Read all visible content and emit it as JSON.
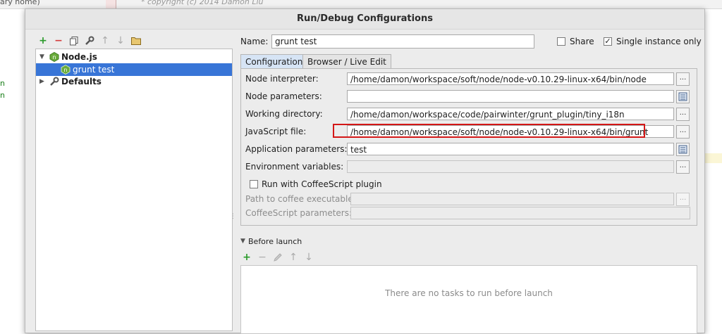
{
  "background": {
    "top_text": "ary home)",
    "code_text": "* copyright (c) 2014 Damon Liu",
    "left_fragments": [
      "n",
      "n"
    ]
  },
  "dialog": {
    "title": "Run/Debug Configurations"
  },
  "left_toolbar": {
    "add": "+",
    "remove": "−",
    "copy": "copy-icon",
    "edit_defaults": "wrench-icon",
    "move_up": "↑",
    "move_down": "↓",
    "folder": "folder-icon"
  },
  "tree": {
    "nodejs": "Node.js",
    "grunt_test": "grunt test",
    "defaults": "Defaults"
  },
  "header": {
    "name_label": "Name:",
    "name_value": "grunt test",
    "share_label": "Share",
    "share_checked": false,
    "single_instance_label": "Single instance only",
    "single_instance_checked": true
  },
  "tabs": [
    {
      "label": "Configuration",
      "active": true
    },
    {
      "label": "Browser / Live Edit",
      "active": false
    }
  ],
  "config": {
    "node_interpreter_label": "Node interpreter:",
    "node_interpreter_value": "/home/damon/workspace/soft/node/node-v0.10.29-linux-x64/bin/node",
    "node_parameters_label": "Node parameters:",
    "node_parameters_value": "",
    "working_directory_label": "Working directory:",
    "working_directory_value": "/home/damon/workspace/code/pairwinter/grunt_plugin/tiny_i18n",
    "javascript_file_label": "JavaScript file:",
    "javascript_file_value": "/home/damon/workspace/soft/node/node-v0.10.29-linux-x64/bin/grunt",
    "application_parameters_label": "Application parameters:",
    "application_parameters_value": "test",
    "environment_variables_label": "Environment variables:",
    "environment_variables_value": "",
    "coffee_label": "Run with CoffeeScript plugin",
    "coffee_checked": false,
    "coffee_path_label": "Path to coffee executable:",
    "coffee_params_label": "CoffeeScript parameters:",
    "browse_label": "..."
  },
  "before_launch": {
    "title": "Before launch",
    "add": "+",
    "remove": "−",
    "up": "↑",
    "down": "↓",
    "empty_message": "There are no tasks to run before launch"
  },
  "colors": {
    "selection": "#3875d7",
    "highlight": "#d41717",
    "add_green": "#2a9a2a",
    "remove_red": "#d43a3a"
  }
}
